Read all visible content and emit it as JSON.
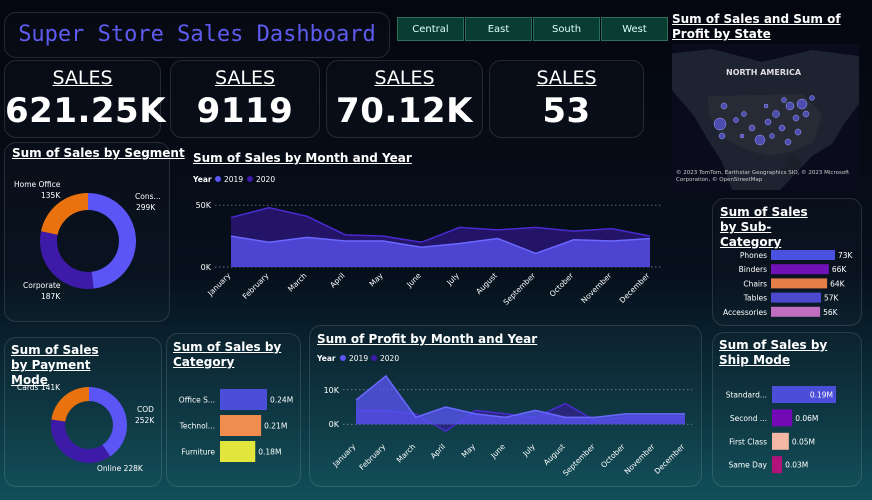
{
  "title": "Super Store Sales Dashboard",
  "regions": [
    "Central",
    "East",
    "South",
    "West"
  ],
  "kpis": [
    {
      "label": "SALES",
      "value": "621.25K"
    },
    {
      "label": "SALES",
      "value": "9119"
    },
    {
      "label": "SALES",
      "value": "70.12K"
    },
    {
      "label": "SALES",
      "value": "53"
    }
  ],
  "map": {
    "title": "Sum of Sales and Sum of Profit by State",
    "region_label": "NORTH AMERICA",
    "attribution": "© 2023 TomTom, Earthstar Geographics SIO, © 2023 Microsoft Corporation, © OpenStreetMap"
  },
  "legend_title": "Year",
  "colors": {
    "y2019": "#5b55f5",
    "y2020": "#3e1aa8"
  },
  "chart_data": [
    {
      "type": "pie",
      "title": "Sum of Sales by Segment",
      "slices": [
        {
          "name": "Cons...",
          "value": 299,
          "label": "299K",
          "color": "#5b55f5"
        },
        {
          "name": "Corporate",
          "value": 187,
          "label": "187K",
          "color": "#3e1aa8"
        },
        {
          "name": "Home Office",
          "value": 135,
          "label": "135K",
          "color": "#ea720e"
        }
      ]
    },
    {
      "type": "area",
      "title": "Sum of Sales by Month and Year",
      "categories": [
        "January",
        "February",
        "March",
        "April",
        "May",
        "June",
        "July",
        "August",
        "September",
        "October",
        "November",
        "December"
      ],
      "series": [
        {
          "name": "2019",
          "values": [
            25,
            20,
            24,
            21,
            21,
            16,
            19,
            23,
            11,
            22,
            21,
            23
          ]
        },
        {
          "name": "2020",
          "values": [
            40,
            48,
            41,
            26,
            25,
            20,
            32,
            30,
            32,
            29,
            31,
            25
          ]
        }
      ],
      "yticks": [
        "50K",
        "0K"
      ],
      "ylim": [
        0,
        55
      ]
    },
    {
      "type": "bar",
      "title": "Sum of Sales by Sub-Category",
      "categories": [
        "Phones",
        "Binders",
        "Chairs",
        "Tables",
        "Accessories"
      ],
      "values": [
        73,
        66,
        64,
        57,
        56
      ],
      "labels": [
        "73K",
        "66K",
        "64K",
        "57K",
        "56K"
      ],
      "colors": [
        "#4a50e0",
        "#7111b8",
        "#e57e47",
        "#4d48cc",
        "#c06ec0"
      ]
    },
    {
      "type": "pie",
      "title": "Sum of Sales by Payment Mode",
      "slices": [
        {
          "name": "COD",
          "value": 252,
          "label": "252K",
          "color": "#5b55f5"
        },
        {
          "name": "Online",
          "value": 228,
          "label": "228K",
          "color": "#3e1aa8"
        },
        {
          "name": "Cards",
          "value": 141,
          "label": "141K",
          "color": "#ea720e"
        }
      ]
    },
    {
      "type": "bar",
      "title": "Sum of Sales by Category",
      "categories": [
        "Office S...",
        "Technol...",
        "Furniture"
      ],
      "values": [
        0.24,
        0.21,
        0.18
      ],
      "labels": [
        "0.24M",
        "0.21M",
        "0.18M"
      ],
      "colors": [
        "#4a4ed8",
        "#ef8c4e",
        "#e2e63c"
      ]
    },
    {
      "type": "area",
      "title": "Sum of Profit by Month and Year",
      "categories": [
        "January",
        "February",
        "March",
        "April",
        "May",
        "June",
        "July",
        "August",
        "September",
        "October",
        "November",
        "December"
      ],
      "series": [
        {
          "name": "2019",
          "values": [
            7,
            14,
            2,
            5,
            3,
            2,
            4,
            2,
            2,
            3,
            3,
            3
          ]
        },
        {
          "name": "2020",
          "values": [
            4,
            4,
            3,
            -2,
            4,
            3,
            2,
            6,
            1,
            2,
            2,
            2
          ]
        }
      ],
      "yticks": [
        "10K",
        "0K"
      ],
      "ylim": [
        -4,
        14
      ]
    },
    {
      "type": "bar",
      "title": "Sum of Sales by Ship Mode",
      "categories": [
        "Standard...",
        "Second ...",
        "First Class",
        "Same Day"
      ],
      "values": [
        0.19,
        0.06,
        0.05,
        0.03
      ],
      "labels": [
        "0.19M",
        "0.06M",
        "0.05M",
        "0.03M"
      ],
      "colors": [
        "#4a4ed8",
        "#7109b6",
        "#f3b7a5",
        "#b0127a"
      ]
    }
  ]
}
